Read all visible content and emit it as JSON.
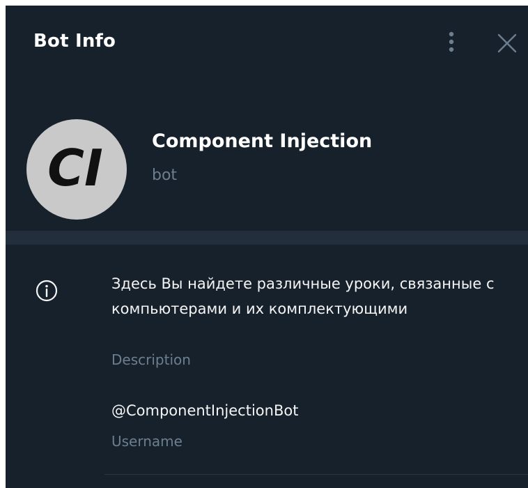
{
  "header": {
    "title": "Bot Info",
    "menu_icon": "more-vertical-icon",
    "close_icon": "close-icon"
  },
  "profile": {
    "avatar_text": "CI",
    "name": "Component Injection",
    "subtitle": "bot"
  },
  "info": {
    "icon": "info-icon",
    "description": "Здесь Вы найдете различные уроки, связанные с компьютерами и их комплектующими",
    "description_label": "Description",
    "username": "@ComponentInjectionBot",
    "username_label": "Username"
  },
  "colors": {
    "background": "#17212b",
    "divider": "#232e3c",
    "secondary_text": "#6d7f8f",
    "avatar_bg": "#c9c9c9"
  }
}
